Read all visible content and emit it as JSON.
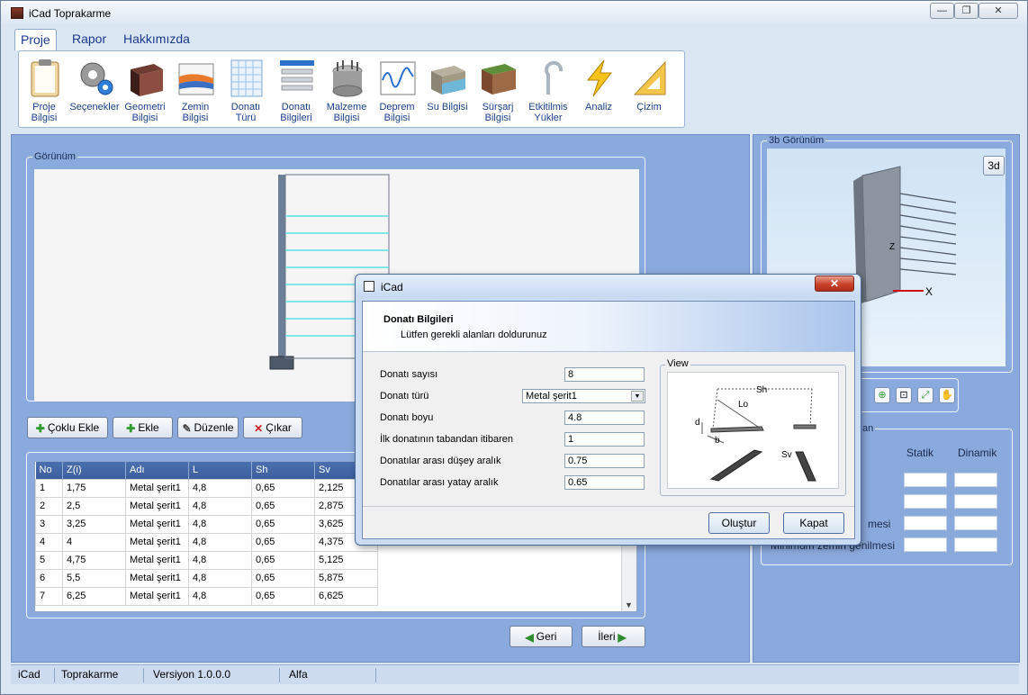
{
  "window": {
    "title": "iCad Toprakarme",
    "min_label": "—",
    "max_label": "❐",
    "close_label": "✕"
  },
  "ribbon": {
    "tabs": [
      "Proje",
      "Rapor",
      "Hakkımızda"
    ],
    "buttons": [
      {
        "label": "Proje Bilgisi",
        "icon": "clipboard-icon"
      },
      {
        "label": "Seçenekler",
        "icon": "gears-icon"
      },
      {
        "label": "Geometri Bilgisi",
        "icon": "block-icon"
      },
      {
        "label": "Zemin Bilgisi",
        "icon": "soil-layers-icon"
      },
      {
        "label": "Donatı Türü",
        "icon": "grid-icon"
      },
      {
        "label": "Donatı Bilgileri",
        "icon": "list-icon"
      },
      {
        "label": "Malzeme Bilgisi",
        "icon": "material-icon"
      },
      {
        "label": "Deprem Bilgisi",
        "icon": "seismic-chart-icon"
      },
      {
        "label": "Su Bilgisi",
        "icon": "water-icon"
      },
      {
        "label": "Sürşarj Bilgisi",
        "icon": "surcharge-icon"
      },
      {
        "label": "Etkitilmis Yükler",
        "icon": "hook-icon"
      },
      {
        "label": "Analiz",
        "icon": "lightning-icon"
      },
      {
        "label": "Çizim",
        "icon": "triangle-ruler-icon"
      }
    ]
  },
  "main": {
    "gorunum_title": "Görünüm",
    "actions": {
      "coklu_ekle": "Çoklu Ekle",
      "ekle": "Ekle",
      "duzenle": "Düzenle",
      "cikar": "Çıkar"
    },
    "table": {
      "headers": [
        "No",
        "Z(i)",
        "Adı",
        "L",
        "Sh",
        "Sv"
      ],
      "rows": [
        [
          "1",
          "1,75",
          "Metal şerit1",
          "4,8",
          "0,65",
          "2,125"
        ],
        [
          "2",
          "2,5",
          "Metal şerit1",
          "4,8",
          "0,65",
          "2,875"
        ],
        [
          "3",
          "3,25",
          "Metal şerit1",
          "4,8",
          "0,65",
          "3,625"
        ],
        [
          "4",
          "4",
          "Metal şerit1",
          "4,8",
          "0,65",
          "4,375"
        ],
        [
          "5",
          "4,75",
          "Metal şerit1",
          "4,8",
          "0,65",
          "5,125"
        ],
        [
          "6",
          "5,5",
          "Metal şerit1",
          "4,8",
          "0,65",
          "5,875"
        ],
        [
          "7",
          "6,25",
          "Metal şerit1",
          "4,8",
          "0,65",
          "6,625"
        ]
      ]
    },
    "nav": {
      "back": "Geri",
      "next": "İleri"
    }
  },
  "right": {
    "view_title": "3b Görünüm",
    "btn_3d": "3d",
    "axis_x": "X",
    "axis_z": "Z",
    "col_static": "Statik",
    "col_dynamic": "Dinamik",
    "row3_label": "mesi",
    "row4_label": "Minimum zemin genilmesi",
    "group_title_fragment": "an"
  },
  "status": {
    "app": "iCad",
    "module": "Toprakarme",
    "version": "Versiyon 1.0.0.0",
    "stage": "Alfa"
  },
  "dialog": {
    "title": "iCad",
    "header_title": "Donatı Bilgileri",
    "header_sub": "Lütfen gerekli alanları doldurunuz",
    "fields": [
      {
        "label": "Donatı sayısı",
        "value": "8"
      },
      {
        "label": "Donatı türü",
        "value": "Metal şerit1"
      },
      {
        "label": "Donatı boyu",
        "value": "4.8"
      },
      {
        "label": "İlk donatının tabandan itibaren",
        "value": "1"
      },
      {
        "label": "Donatılar arası düşey aralık",
        "value": "0.75"
      },
      {
        "label": "Donatılar arası yatay aralık",
        "value": "0.65"
      }
    ],
    "view_title": "View",
    "diagram_labels": {
      "sh": "Sh",
      "lo": "Lo",
      "d": "d",
      "b": "b",
      "sv": "Sv"
    },
    "buttons": {
      "create": "Oluştur",
      "close": "Kapat"
    },
    "close_label": "✕"
  }
}
